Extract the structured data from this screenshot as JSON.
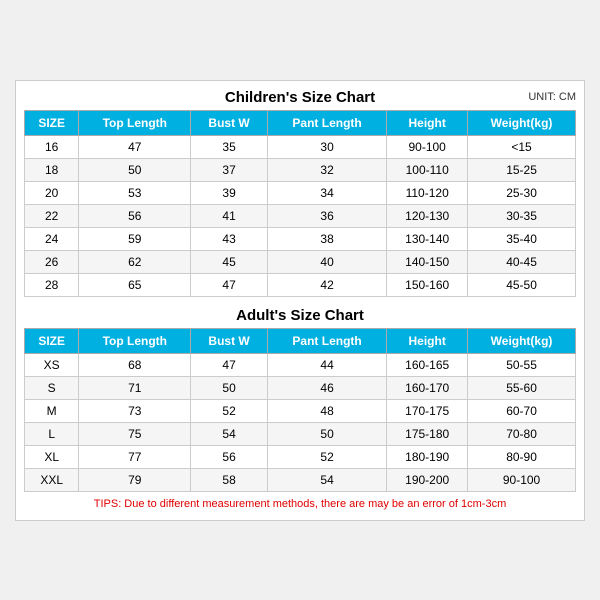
{
  "page": {
    "unit_label": "UNIT: CM",
    "children_section": {
      "title": "Children's Size Chart",
      "columns": [
        "SIZE",
        "Top Length",
        "Bust W",
        "Pant Length",
        "Height",
        "Weight(kg)"
      ],
      "rows": [
        [
          "16",
          "47",
          "35",
          "30",
          "90-100",
          "<15"
        ],
        [
          "18",
          "50",
          "37",
          "32",
          "100-110",
          "15-25"
        ],
        [
          "20",
          "53",
          "39",
          "34",
          "110-120",
          "25-30"
        ],
        [
          "22",
          "56",
          "41",
          "36",
          "120-130",
          "30-35"
        ],
        [
          "24",
          "59",
          "43",
          "38",
          "130-140",
          "35-40"
        ],
        [
          "26",
          "62",
          "45",
          "40",
          "140-150",
          "40-45"
        ],
        [
          "28",
          "65",
          "47",
          "42",
          "150-160",
          "45-50"
        ]
      ]
    },
    "adult_section": {
      "title": "Adult's Size Chart",
      "columns": [
        "SIZE",
        "Top Length",
        "Bust W",
        "Pant Length",
        "Height",
        "Weight(kg)"
      ],
      "rows": [
        [
          "XS",
          "68",
          "47",
          "44",
          "160-165",
          "50-55"
        ],
        [
          "S",
          "71",
          "50",
          "46",
          "160-170",
          "55-60"
        ],
        [
          "M",
          "73",
          "52",
          "48",
          "170-175",
          "60-70"
        ],
        [
          "L",
          "75",
          "54",
          "50",
          "175-180",
          "70-80"
        ],
        [
          "XL",
          "77",
          "56",
          "52",
          "180-190",
          "80-90"
        ],
        [
          "XXL",
          "79",
          "58",
          "54",
          "190-200",
          "90-100"
        ]
      ]
    },
    "tips": "TIPS: Due to different measurement methods, there are may be an error of 1cm-3cm"
  }
}
